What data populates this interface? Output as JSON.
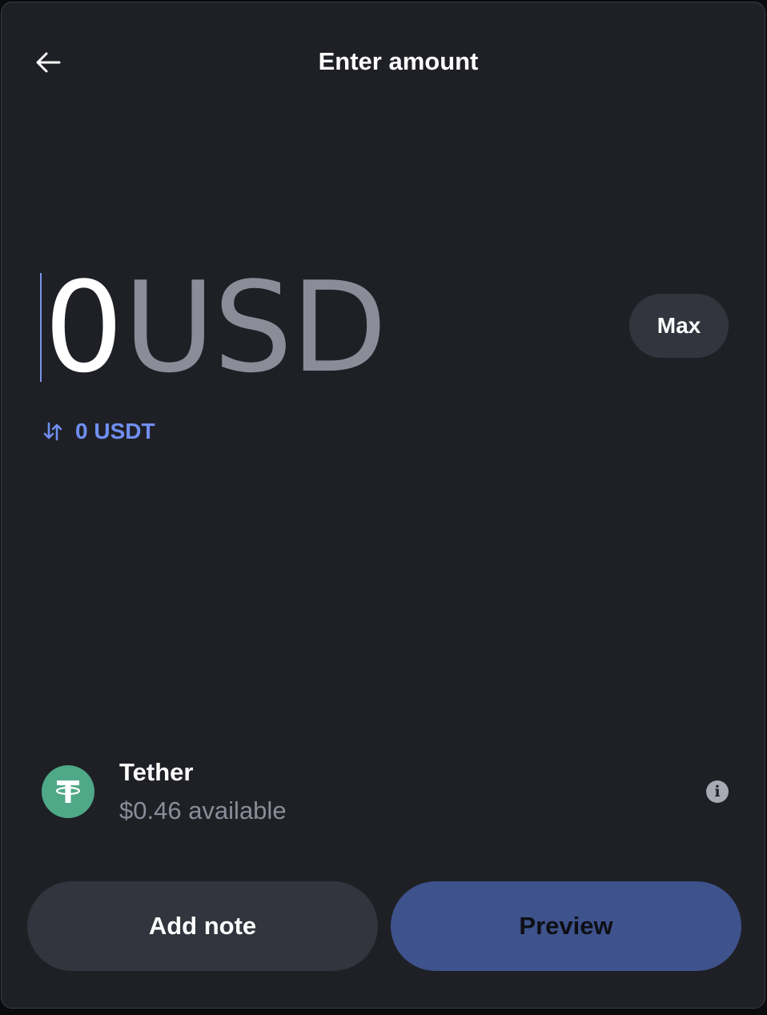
{
  "header": {
    "title": "Enter amount",
    "back_icon": "arrow-left-icon"
  },
  "amount": {
    "value": "0",
    "currency": "USD",
    "max_label": "Max"
  },
  "conversion": {
    "icon": "swap-vertical-icon",
    "text": "0 USDT"
  },
  "asset": {
    "name": "Tether",
    "available": "$0.46 available",
    "logo_icon": "tether-logo",
    "info_icon": "info-icon",
    "logo_color": "#4fa887"
  },
  "actions": {
    "add_note_label": "Add note",
    "preview_label": "Preview"
  },
  "colors": {
    "background": "#1f2026",
    "accent": "#6f8ff2",
    "preview_button": "#3e528c",
    "secondary_button": "#32353d"
  }
}
